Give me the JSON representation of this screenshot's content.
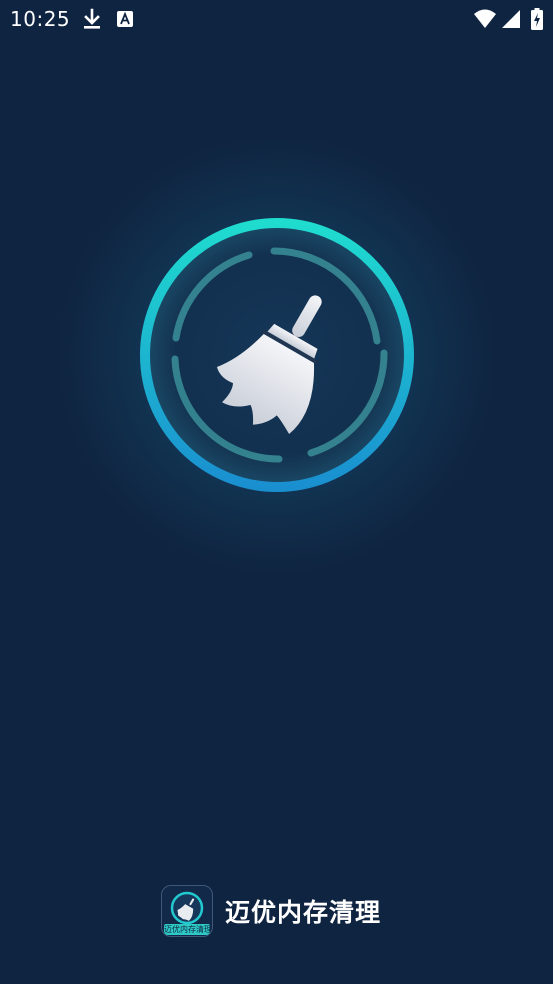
{
  "status_bar": {
    "time": "10:25",
    "icons": [
      "download-icon",
      "a-notification-icon",
      "wifi-icon",
      "signal-icon",
      "battery-charging-icon"
    ]
  },
  "splash": {
    "logo_icon": "broom-icon",
    "colors": {
      "background": "#0f2440",
      "ring_top": "#1fdccf",
      "ring_bottom": "#1a8fd0",
      "broom": "#e8ebf0"
    }
  },
  "footer": {
    "app_icon_caption": "迈优内存清理",
    "app_name": "迈优内存清理"
  }
}
